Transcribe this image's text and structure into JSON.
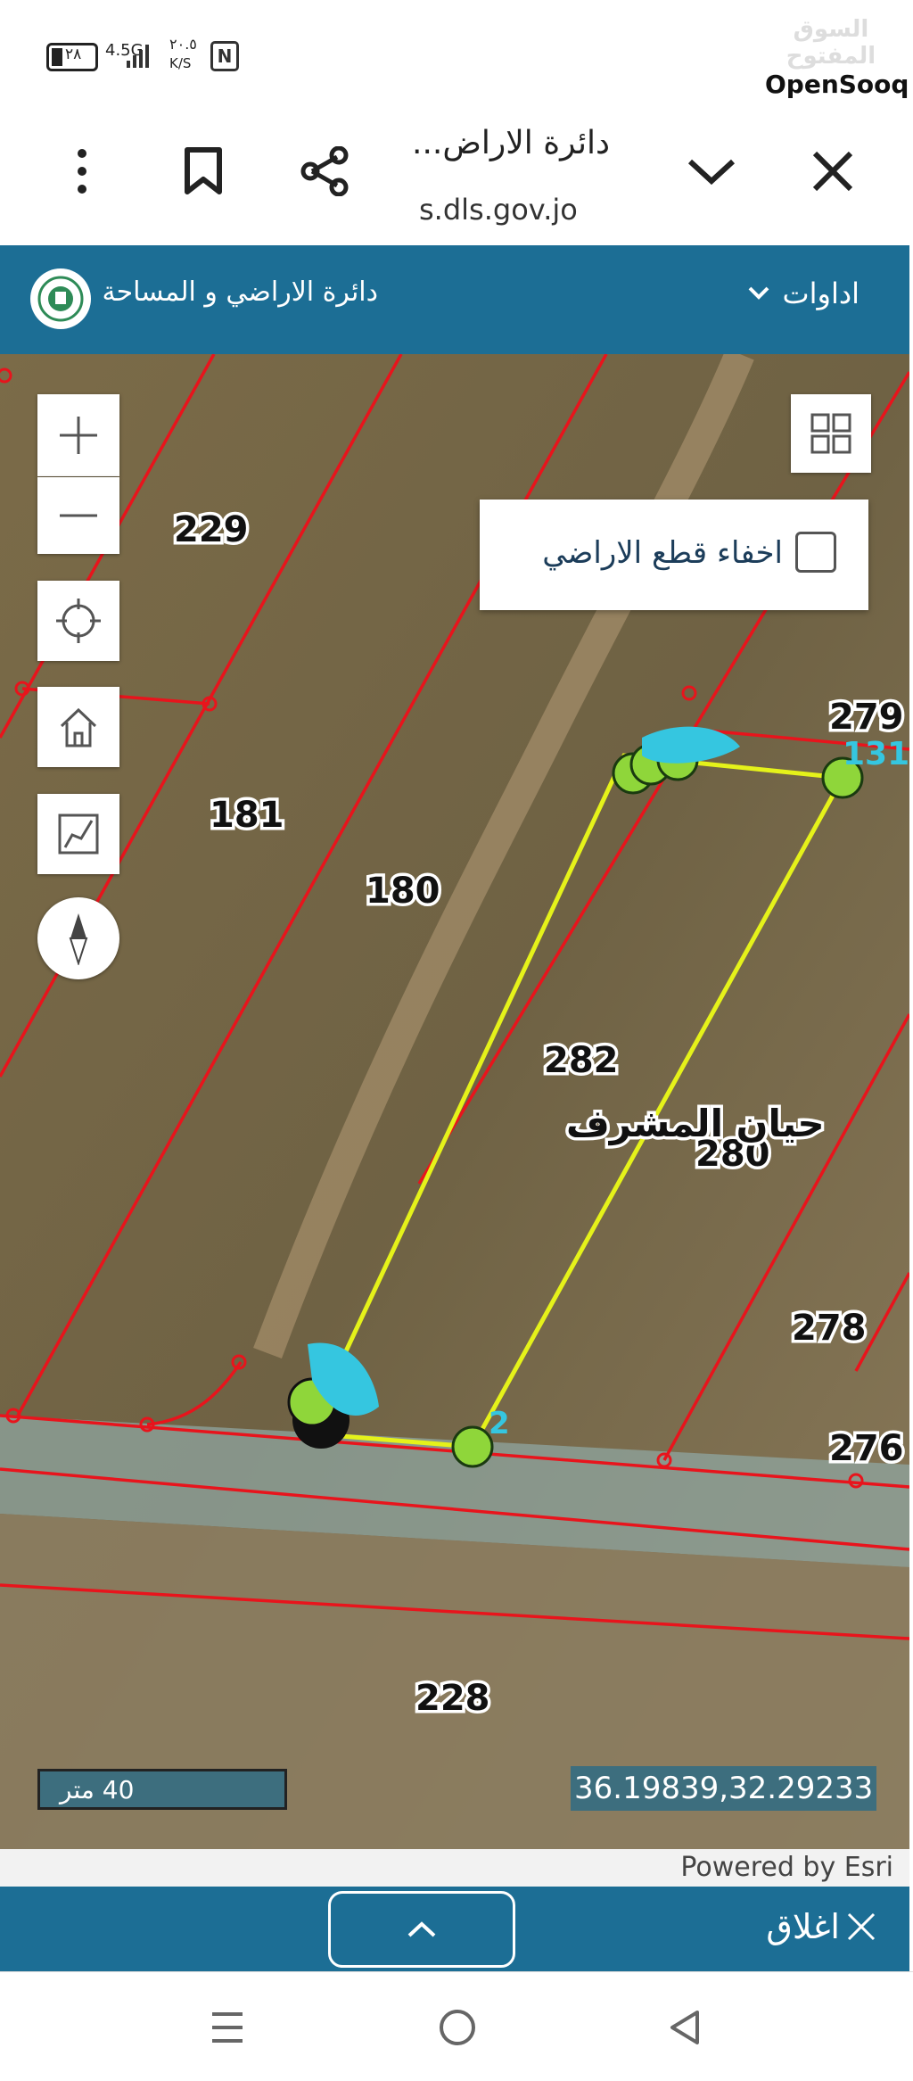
{
  "status_bar": {
    "battery": "٢٨",
    "network": "4.5G",
    "speed_value": "٢٠.٥",
    "speed_unit": "K/S",
    "nfc": "N",
    "watermark_arabic": "السوق المفتوح",
    "watermark_brand": "OpenSooq"
  },
  "browser": {
    "page_title": "دائرة الاراض...",
    "url": "s.dls.gov.jo",
    "icons": [
      "more-vertical-icon",
      "bookmark-icon",
      "share-icon",
      "chevron-down-icon",
      "close-icon"
    ]
  },
  "site_header": {
    "title": "دائرة الاراضي و المساحة",
    "tools_label": "اداوات"
  },
  "map": {
    "hide_parcels_label": "اخفاء قطع الاراضي",
    "hide_parcels_checked": false,
    "area_name": "حيان المشرف",
    "parcels": [
      "229",
      "181",
      "180",
      "282",
      "280",
      "279",
      "278",
      "276",
      "228"
    ],
    "vertex_labels": [
      "131",
      "2"
    ],
    "scale_label": "40 متر",
    "coordinates": "36.19839,32.29233",
    "attribution": "Powered by Esri",
    "controls": [
      "zoom-in",
      "zoom-out",
      "locate",
      "home",
      "measure",
      "compass",
      "layers"
    ],
    "colors": {
      "parcel_line": "#e8141c",
      "selection_line": "#e5f21a",
      "vertex_fill": "#8fd63a",
      "vertex_label": "#35c6e0"
    }
  },
  "bottom_panel": {
    "close_label": "اغلاق"
  },
  "nav_bar": {
    "buttons": [
      "menu",
      "home",
      "back"
    ]
  }
}
